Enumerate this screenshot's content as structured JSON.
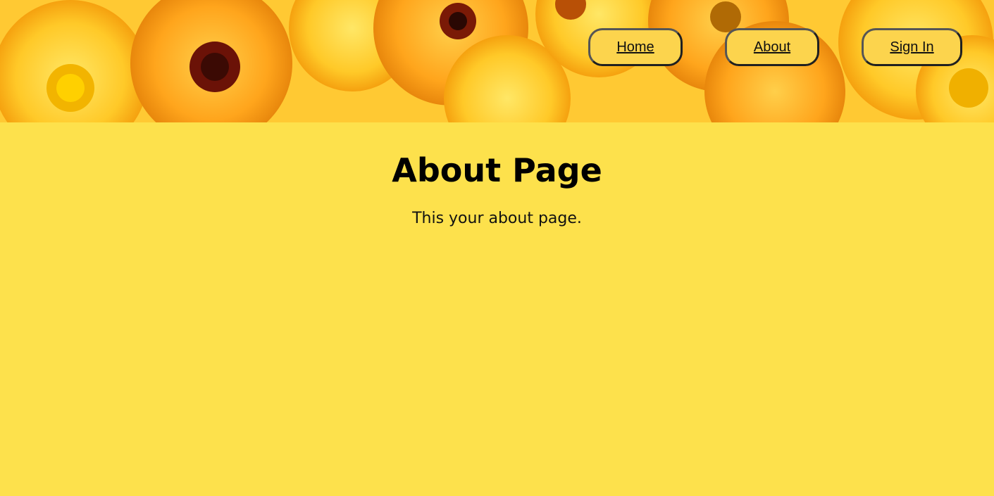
{
  "header": {
    "background": "yellow-orange-flowers-image"
  },
  "nav": {
    "home_label": "Home",
    "about_label": "About",
    "signin_label": "Sign In"
  },
  "main": {
    "title": "About Page",
    "body": "This your about page."
  },
  "colors": {
    "page_background": "#fde14c",
    "button_background": "#fcd44d",
    "button_border": "#202020",
    "text": "#000000"
  }
}
